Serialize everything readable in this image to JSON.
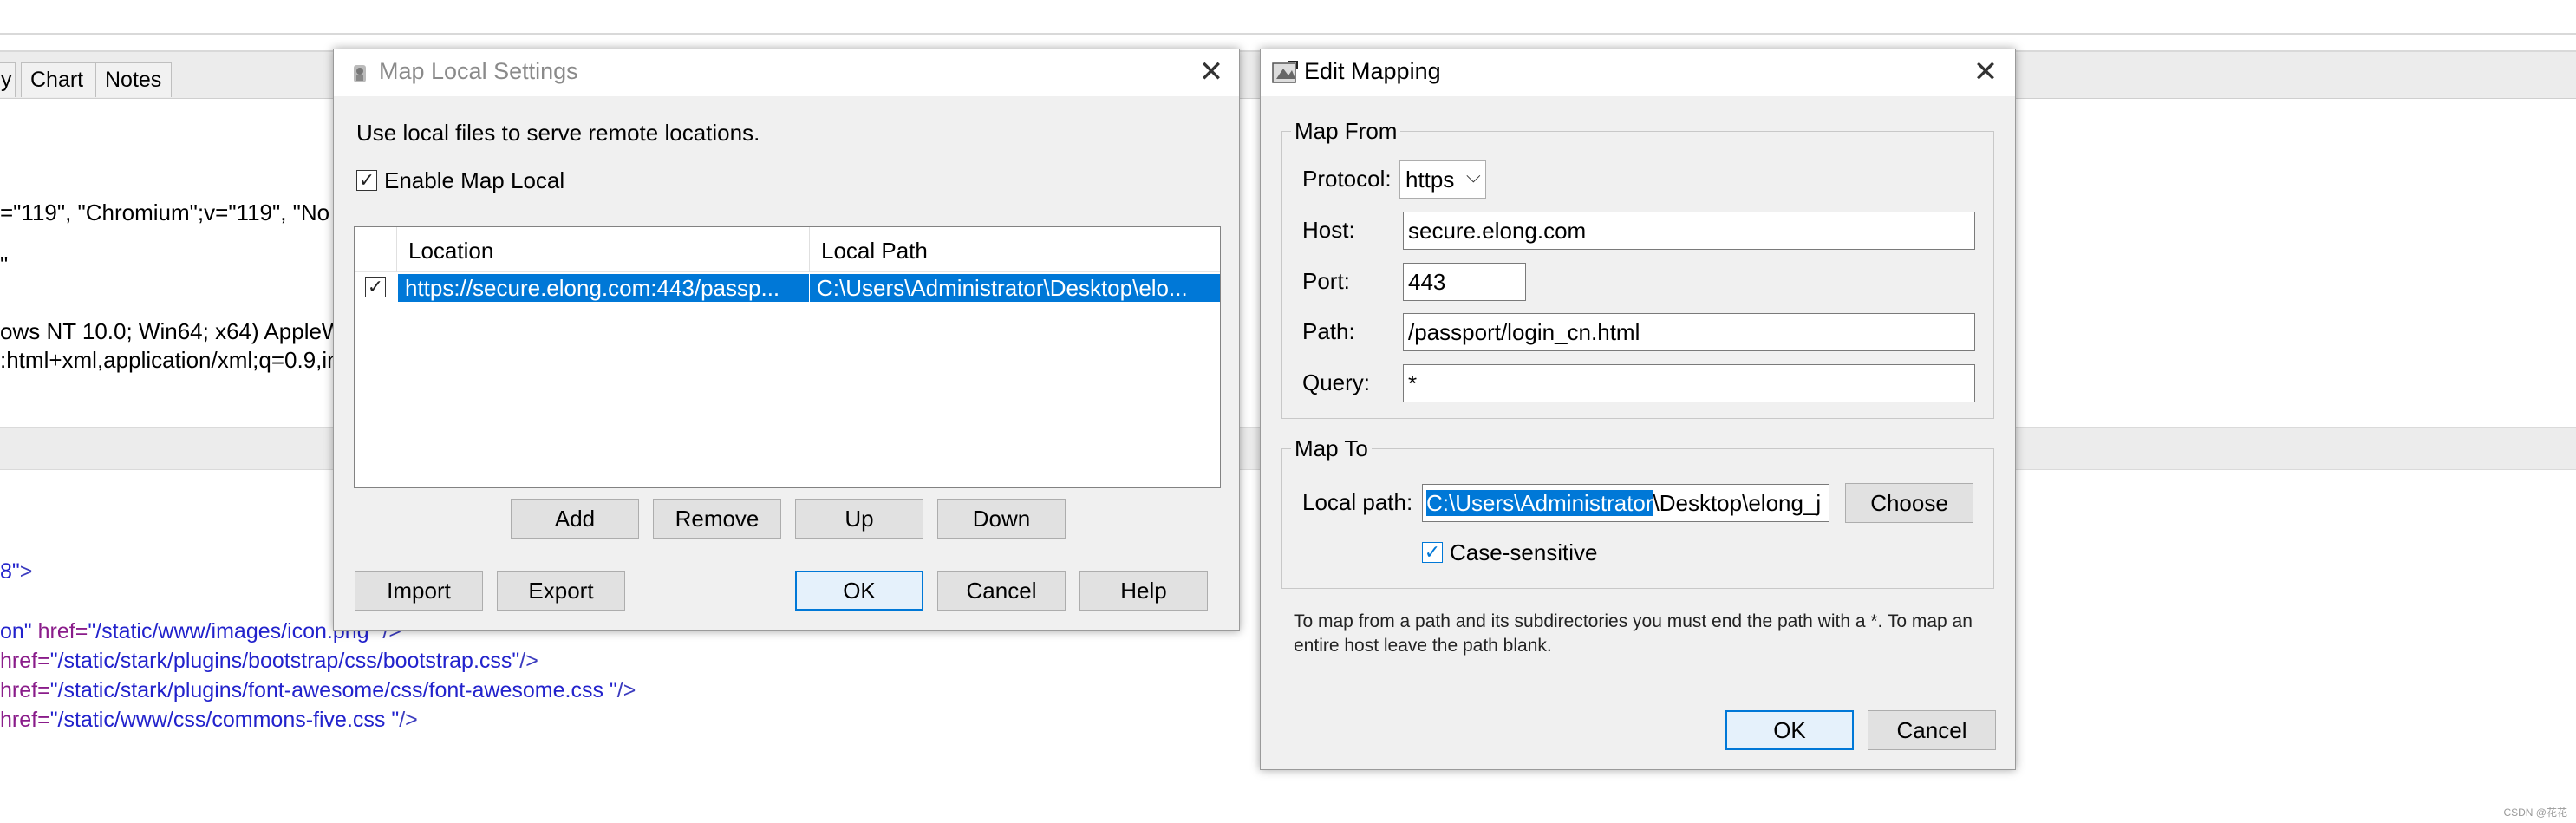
{
  "background_app": {
    "tabs": [
      "y",
      "Chart",
      "Notes"
    ],
    "header_lines": [
      "=\"119\", \"Chromium\";v=\"119\", \"No",
      "\"",
      "ows NT 10.0; Win64; x64) AppleW",
      ":html+xml,application/xml;q=0.9,in"
    ],
    "code_lines": [
      {
        "a": "8\"",
        "b": ">",
        "c": "",
        "d": ""
      },
      {
        "a": "on\"",
        "b": " href=",
        "c": "\"/static/www/images/icon.png\"",
        "d": " />"
      },
      {
        "a": "",
        "b": " href=",
        "c": "\"/static/stark/plugins/bootstrap/css/bootstrap.css\"",
        "d": "/>"
      },
      {
        "a": "",
        "b": " href=",
        "c": "\"/static/stark/plugins/font-awesome/css/font-awesome.css \"",
        "d": "/>"
      },
      {
        "a": "",
        "b": " href=",
        "c": "\"/static/www/css/commons-five.css \"",
        "d": "/>"
      }
    ]
  },
  "map_local": {
    "title": "Map Local Settings",
    "description": "Use local files to serve remote locations.",
    "enable_label": "Enable Map Local",
    "enable_checked": true,
    "table": {
      "columns": [
        "Location",
        "Local Path"
      ],
      "rows": [
        {
          "checked": true,
          "location": "https://secure.elong.com:443/passp...",
          "local_path": "C:\\Users\\Administrator\\Desktop\\elo..."
        }
      ]
    },
    "buttons": {
      "add": "Add",
      "remove": "Remove",
      "up": "Up",
      "down": "Down",
      "import": "Import",
      "export": "Export",
      "ok": "OK",
      "cancel": "Cancel",
      "help": "Help"
    }
  },
  "edit_mapping": {
    "title": "Edit Mapping",
    "map_from": {
      "group_label": "Map From",
      "protocol_label": "Protocol:",
      "protocol_value": "https",
      "host_label": "Host:",
      "host_value": "secure.elong.com",
      "port_label": "Port:",
      "port_value": "443",
      "path_label": "Path:",
      "path_value": "/passport/login_cn.html",
      "query_label": "Query:",
      "query_value": "*"
    },
    "map_to": {
      "group_label": "Map To",
      "local_path_label": "Local path:",
      "local_path_selected": "C:\\Users\\Administrator",
      "local_path_rest": "\\Desktop\\elong_j",
      "choose_label": "Choose",
      "case_label": "Case-sensitive",
      "case_checked": true
    },
    "hint": "To map from a path and its subdirectories you must end the path with a *. To map an entire host leave the path blank.",
    "buttons": {
      "ok": "OK",
      "cancel": "Cancel"
    }
  },
  "watermark": "CSDN @花花",
  "colors": {
    "selection": "#0078d7",
    "dialog_bg": "#f0f0f0"
  }
}
